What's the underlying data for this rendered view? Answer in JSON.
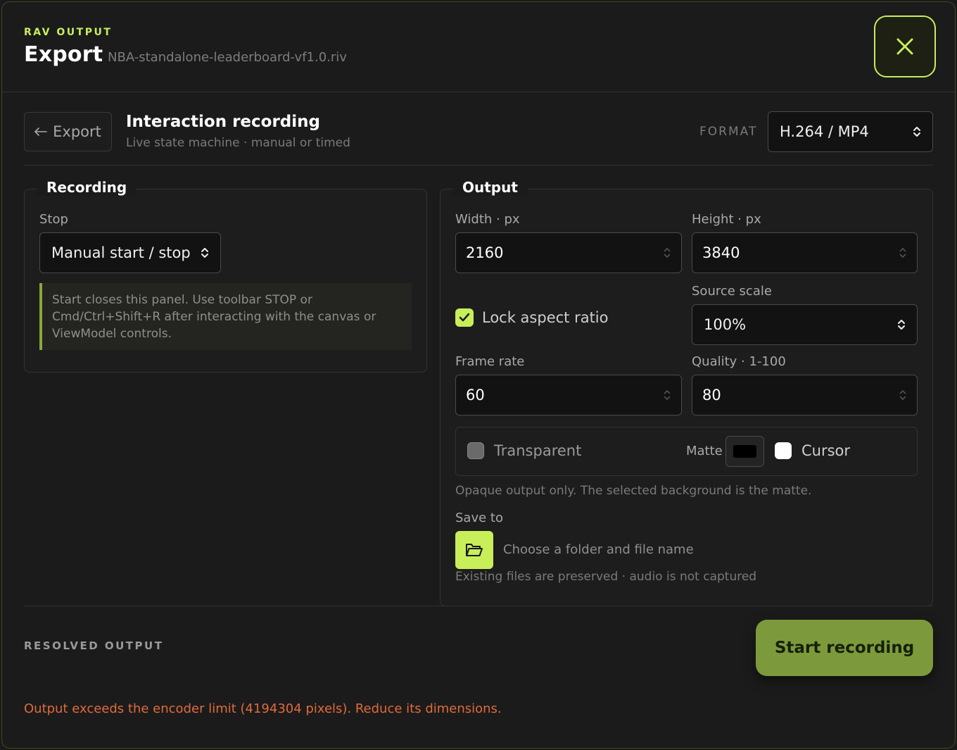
{
  "header": {
    "eyebrow": "RAV OUTPUT",
    "title": "Export",
    "filename": "NBA-standalone-leaderboard-vf1.0.riv"
  },
  "subheader": {
    "back_label": "Export",
    "section_title": "Interaction recording",
    "section_subtitle": "Live state machine · manual or timed",
    "format_label": "FORMAT",
    "format_value": "H.264 / MP4"
  },
  "recording": {
    "legend": "Recording",
    "stop_label": "Stop",
    "stop_value": "Manual start / stop",
    "note": "Start closes this panel. Use toolbar STOP or Cmd/Ctrl+Shift+R after interacting with the canvas or ViewModel controls."
  },
  "output": {
    "legend": "Output",
    "width_label": "Width · px",
    "width_value": "2160",
    "height_label": "Height · px",
    "height_value": "3840",
    "lock_label": "Lock aspect ratio",
    "lock_checked": true,
    "source_scale_label": "Source scale",
    "source_scale_value": "100%",
    "frame_rate_label": "Frame rate",
    "frame_rate_value": "60",
    "quality_label": "Quality · 1-100",
    "quality_value": "80",
    "transparent_label": "Transparent",
    "transparent_checked": false,
    "matte_label": "Matte",
    "matte_color": "#000000",
    "cursor_label": "Cursor",
    "cursor_checked": false,
    "opaque_note": "Opaque output only. The selected background is the matte.",
    "save_to_label": "Save to",
    "save_placeholder": "Choose a folder and file name",
    "save_note": "Existing files are preserved · audio is not captured"
  },
  "footer": {
    "resolved_label": "RESOLVED OUTPUT",
    "start_label": "Start recording",
    "error": "Output exceeds the encoder limit (4194304 pixels). Reduce its dimensions."
  },
  "colors": {
    "accent": "#c8ee5a",
    "start_button": "#7c9a3b",
    "error": "#e06a3c"
  }
}
